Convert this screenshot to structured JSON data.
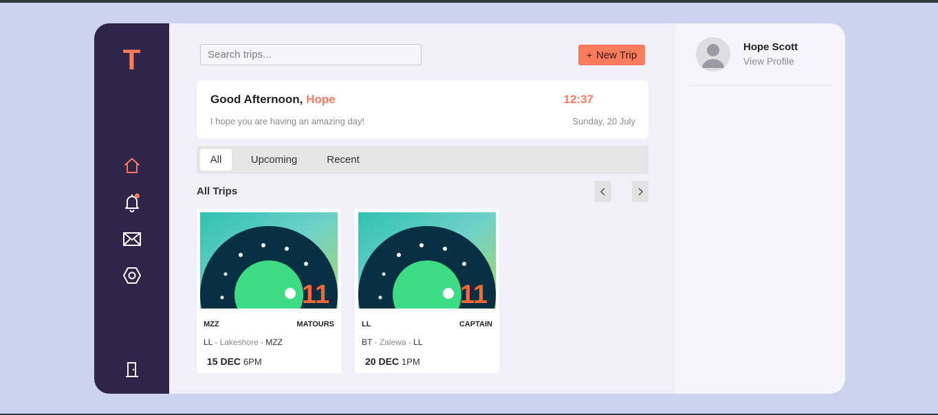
{
  "app": {
    "logo": "T"
  },
  "sidebar": {
    "items": [
      {
        "icon": "home-icon",
        "active": true
      },
      {
        "icon": "bell-icon",
        "badge": true
      },
      {
        "icon": "mail-icon"
      },
      {
        "icon": "settings-icon"
      }
    ],
    "logout_icon": "door-icon"
  },
  "header": {
    "search_placeholder": "Search trips...",
    "new_trip_plus": "+",
    "new_trip_label": "New Trip"
  },
  "greeting": {
    "prefix": "Good Afternoon, ",
    "name": "Hope",
    "time": "12:37",
    "subtitle": "I hope you are having an amazing day!",
    "date": "Sunday, 20 July"
  },
  "tabs": [
    {
      "label": "All",
      "active": true
    },
    {
      "label": "Upcoming",
      "active": false
    },
    {
      "label": "Recent",
      "active": false
    }
  ],
  "trips_section": {
    "title": "All Trips"
  },
  "trips": [
    {
      "code": "MZZ",
      "company": "MATOURS",
      "route_start": "LL",
      "route_sep1": " - ",
      "route_mid": "Lakeshore",
      "route_sep2": " - ",
      "route_end": "MZZ",
      "date": "15 DEC",
      "time": "6PM",
      "image_badge": "11"
    },
    {
      "code": "LL",
      "company": "CAPTAIN",
      "route_start": "BT",
      "route_sep1": " - ",
      "route_mid": "Zalewa",
      "route_sep2": " - ",
      "route_end": "LL",
      "date": "20 DEC",
      "time": "1PM",
      "image_badge": "11"
    }
  ],
  "profile": {
    "name": "Hope Scott",
    "link": "View Profile"
  },
  "colors": {
    "accent": "#ff7b5c",
    "sidebar": "#2e2549",
    "background": "#ccd3ee",
    "card_teal": "#3cc9b4",
    "card_green": "#3ddc84",
    "card_navy": "#073042"
  }
}
